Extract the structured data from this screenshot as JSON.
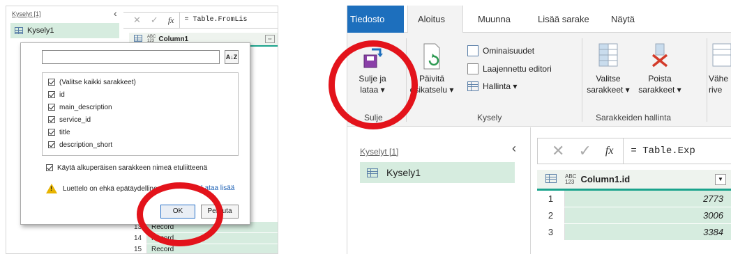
{
  "left": {
    "queries_title": "Kyselyt [1]",
    "query_name": "Kysely1",
    "formula_text": "= Table.FromLis",
    "column_header": "Column1",
    "type_abc": "ABC",
    "type_123": "123",
    "rows": [
      {
        "num": "13",
        "value": "Record"
      },
      {
        "num": "14",
        "value": "Record"
      },
      {
        "num": "15",
        "value": "Record"
      }
    ]
  },
  "dialog": {
    "items": [
      "(Valitse kaikki sarakkeet)",
      "id",
      "main_description",
      "service_id",
      "title",
      "description_short"
    ],
    "prefix_label": "Käytä alkuperäisen sarakkeen nimeä etuliitteenä",
    "warning_text": "Luettelo on ehkä epätäydellinen.",
    "load_more": "Lataa lisää",
    "ok_label": "OK",
    "cancel_label": "Peruuta"
  },
  "right": {
    "tabs": {
      "file": "Tiedosto",
      "home": "Aloitus",
      "transform": "Muunna",
      "add_column": "Lisää sarake",
      "view": "Näytä"
    },
    "ribbon": {
      "close_load_line1": "Sulje ja",
      "close_load_line2": "lataa ▾",
      "close_group": "Sulje",
      "refresh_line1": "Päivitä",
      "refresh_line2": "esikatselu ▾",
      "properties": "Ominaisuudet",
      "advanced_editor": "Laajennettu editori",
      "manage": "Hallinta ▾",
      "query_group": "Kysely",
      "choose_line1": "Valitse",
      "choose_line2": "sarakkeet ▾",
      "remove_line1": "Poista",
      "remove_line2": "sarakkeet ▾",
      "columns_group": "Sarakkeiden hallinta",
      "reduce_line1": "Vähe",
      "reduce_line2": "rive"
    },
    "queries_title": "Kyselyt [1]",
    "query_name": "Kysely1",
    "formula_text": "= Table.Exp",
    "column_header": "Column1.id",
    "type_abc": "ABC",
    "type_123": "123",
    "rows": [
      {
        "num": "1",
        "value": "2773"
      },
      {
        "num": "2",
        "value": "3006"
      },
      {
        "num": "3",
        "value": "3384"
      }
    ]
  },
  "colors": {
    "accent_file_tab": "#1d6fbd",
    "selection_green": "#d6ecdf",
    "header_teal": "#1aa38c",
    "annotation_red": "#e3131b"
  }
}
